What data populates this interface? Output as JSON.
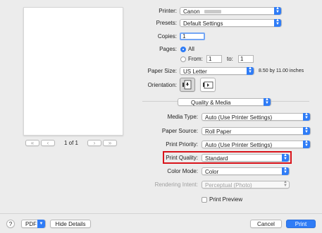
{
  "preview": {
    "page_indicator": "1 of 1",
    "first_label": "«",
    "prev_label": "‹",
    "next_label": "›",
    "last_label": "»"
  },
  "form": {
    "printer": {
      "label": "Printer:",
      "value": "Canon"
    },
    "presets": {
      "label": "Presets:",
      "value": "Default Settings"
    },
    "copies": {
      "label": "Copies:",
      "value": "1"
    },
    "pages": {
      "label": "Pages:",
      "all_label": "All",
      "from_label": "From:",
      "from_value": "1",
      "to_label": "to:",
      "to_value": "1"
    },
    "paper_size": {
      "label": "Paper Size:",
      "value": "US Letter",
      "dimensions": "8.50 by 11.00 inches"
    },
    "orientation": {
      "label": "Orientation:"
    },
    "section": {
      "value": "Quality & Media"
    },
    "media_type": {
      "label": "Media Type:",
      "value": "Auto (Use Printer Settings)"
    },
    "paper_source": {
      "label": "Paper Source:",
      "value": "Roll Paper"
    },
    "print_priority": {
      "label": "Print Priority:",
      "value": "Auto (Use Printer Settings)"
    },
    "print_quality": {
      "label": "Print Quality:",
      "value": "Standard"
    },
    "color_mode": {
      "label": "Color Mode:",
      "value": "Color"
    },
    "rendering_intent": {
      "label": "Rendering Intent:",
      "value": "Perceptual (Photo)"
    },
    "print_preview": {
      "label": "Print Preview"
    }
  },
  "footer": {
    "help_label": "?",
    "pdf_label": "PDF",
    "hide_details_label": "Hide Details",
    "cancel_label": "Cancel",
    "print_label": "Print"
  },
  "colors": {
    "accent": "#2f7cf6",
    "highlight_border": "#d9141b"
  }
}
